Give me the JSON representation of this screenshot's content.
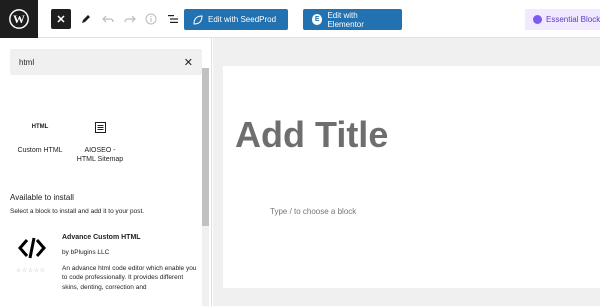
{
  "toolbar": {
    "seedprod_label": "Edit with SeedProd",
    "elementor_label": "Edit with Elementor",
    "essential_label": "Essential Blocks"
  },
  "inserter": {
    "search_value": "html",
    "blocks": [
      {
        "label_line1": "Custom HTML",
        "label_line2": "",
        "icon_text": "HTML"
      },
      {
        "label_line1": "AIOSEO -",
        "label_line2": "HTML Sitemap"
      }
    ],
    "available_title": "Available to install",
    "available_desc": "Select a block to install and add it to your post.",
    "plugin": {
      "name": "Advance Custom HTML",
      "author": "by bPlugins LLC",
      "desc": "An advance html code editor which enable you to code professionally. It provides different skins, denting, correction and",
      "stars": "☆☆☆☆☆"
    }
  },
  "editor": {
    "title_placeholder": "Add Title",
    "block_hint": "Type / to choose a block"
  }
}
